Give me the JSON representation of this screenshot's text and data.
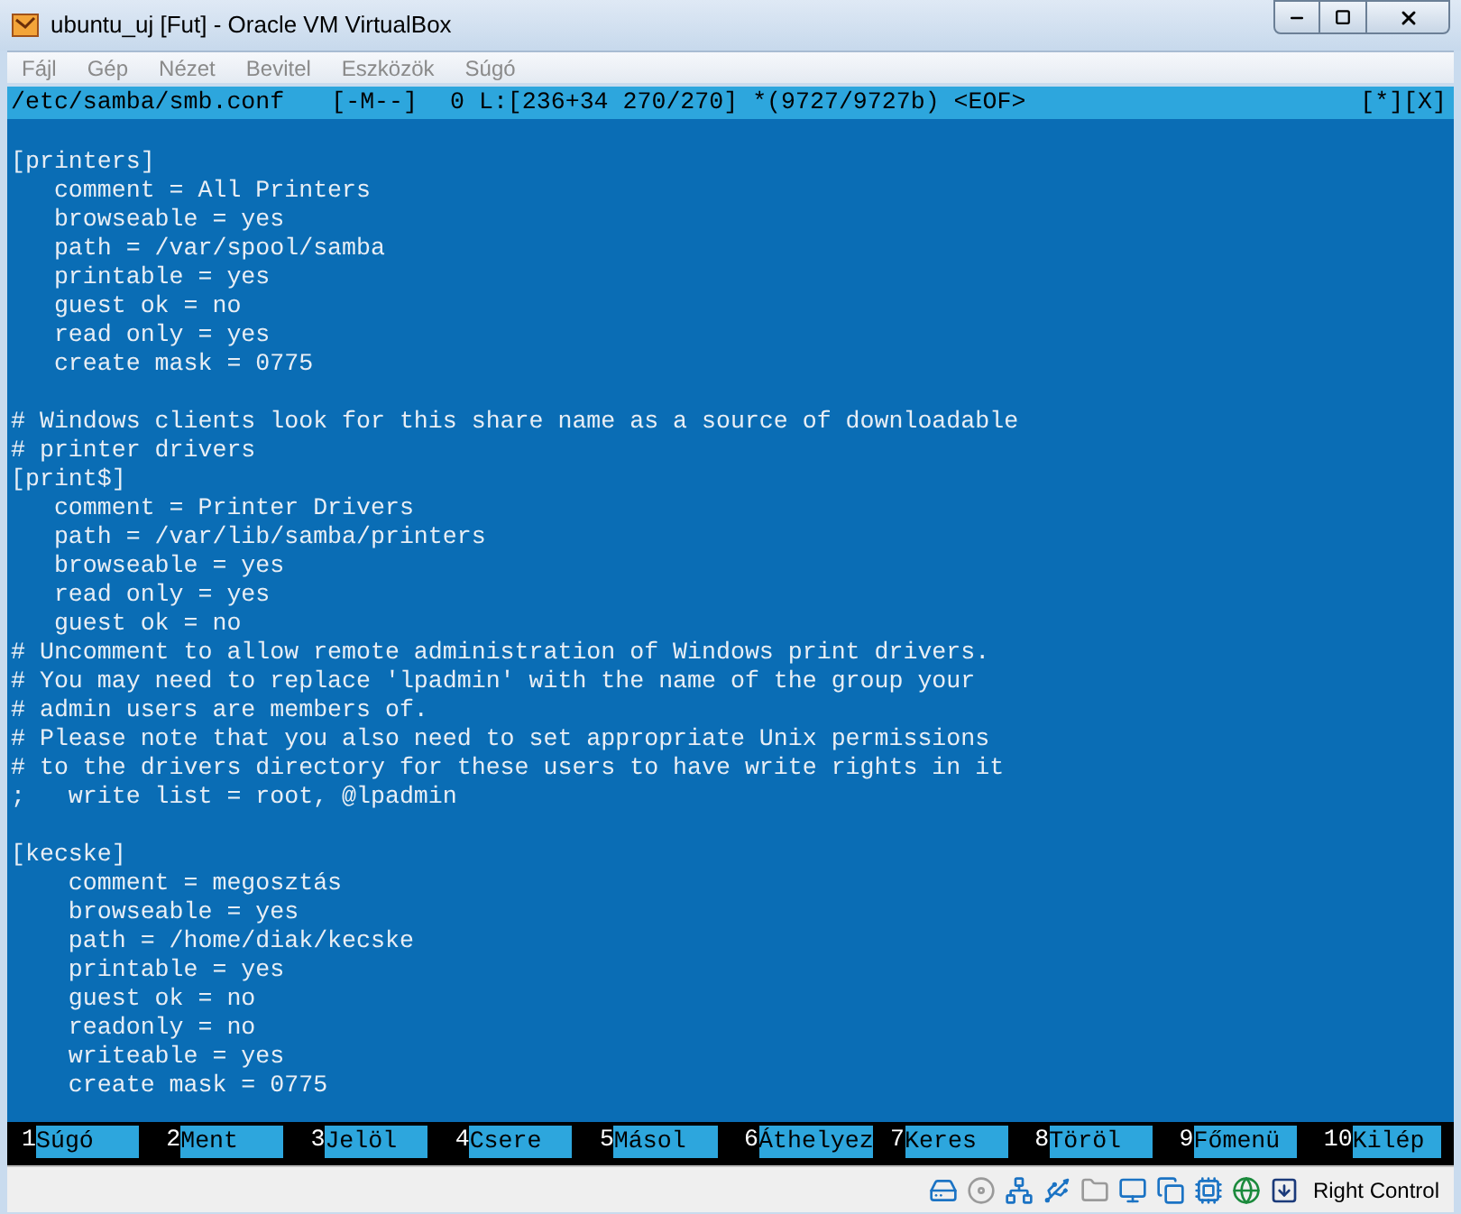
{
  "window": {
    "title": "ubuntu_uj [Fut] - Oracle VM VirtualBox"
  },
  "menu": [
    "Fájl",
    "Gép",
    "Nézet",
    "Bevitel",
    "Eszközök",
    "Súgó"
  ],
  "editor": {
    "header": {
      "file": "/etc/samba/smb.conf",
      "mode": "[-M--]",
      "position": "0 L:[236+34 270/270] *(9727/9727b) <EOF>",
      "buttons": "[*][X]"
    },
    "blocks": [
      [
        "[printers]",
        "   comment = All Printers",
        "   browseable = yes",
        "   path = /var/spool/samba",
        "   printable = yes",
        "   guest ok = no",
        "   read only = yes",
        "   create mask = 0775"
      ],
      [
        "# Windows clients look for this share name as a source of downloadable",
        "# printer drivers",
        "[print$]",
        "   comment = Printer Drivers",
        "   path = /var/lib/samba/printers",
        "   browseable = yes",
        "   read only = yes",
        "   guest ok = no",
        "# Uncomment to allow remote administration of Windows print drivers.",
        "# You may need to replace 'lpadmin' with the name of the group your",
        "# admin users are members of.",
        "# Please note that you also need to set appropriate Unix permissions",
        "# to the drivers directory for these users to have write rights in it",
        ";   write list = root, @lpadmin"
      ],
      [
        "[kecske]",
        "    comment = megosztás",
        "    browseable = yes",
        "    path = /home/diak/kecske",
        "    printable = yes",
        "    guest ok = no",
        "    readonly = no",
        "    writeable = yes",
        "    create mask = 0775"
      ]
    ]
  },
  "function_keys": [
    {
      "number": "1",
      "label": "Súgó"
    },
    {
      "number": "2",
      "label": "Ment"
    },
    {
      "number": "3",
      "label": "Jelöl"
    },
    {
      "number": "4",
      "label": "Csere"
    },
    {
      "number": "5",
      "label": "Másol"
    },
    {
      "number": "6",
      "label": "Áthelyez"
    },
    {
      "number": "7",
      "label": "Keres"
    },
    {
      "number": "8",
      "label": "Töröl"
    },
    {
      "number": "9",
      "label": "Főmenü"
    },
    {
      "number": "10",
      "label": "Kilép"
    }
  ],
  "status_bar": {
    "host_key": "Right Control"
  }
}
